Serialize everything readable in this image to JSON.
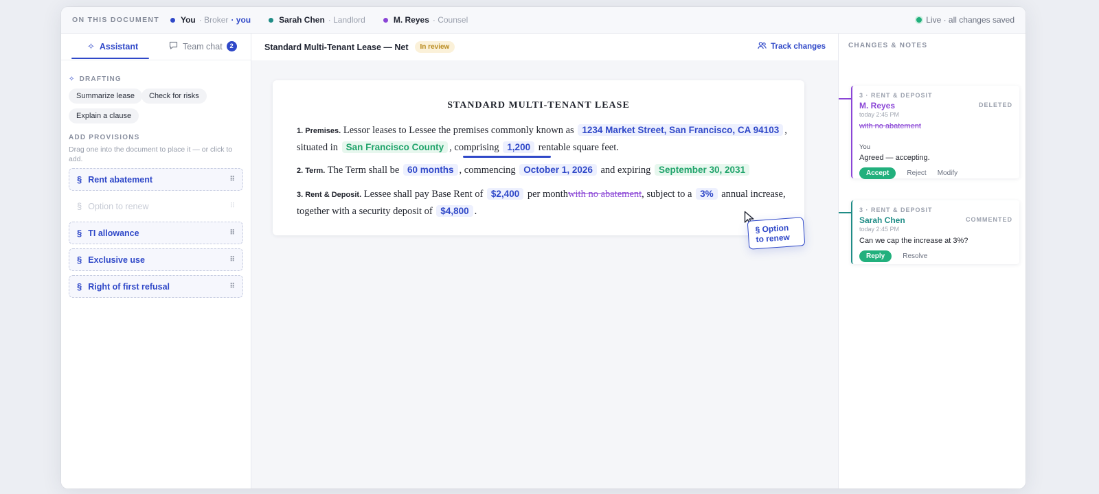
{
  "topbar": {
    "label": "ON THIS DOCUMENT",
    "participants": [
      {
        "name": "You",
        "role": "· Broker",
        "tag": "· you",
        "color": "#2f48c8"
      },
      {
        "name": "Sarah Chen",
        "role": "· Landlord",
        "tag": "",
        "color": "#1f8c86"
      },
      {
        "name": "M. Reyes",
        "role": "· Counsel",
        "tag": "",
        "color": "#8a45d6"
      }
    ],
    "live_status": "Live · all changes saved"
  },
  "left": {
    "tabs": {
      "assistant": "Assistant",
      "team_chat": "Team chat",
      "team_chat_badge": "2"
    },
    "drafting": {
      "heading": "DRAFTING",
      "actions": [
        "Summarize lease",
        "Check for risks",
        "Explain a clause"
      ]
    },
    "provisions": {
      "heading": "ADD PROVISIONS",
      "hint": "Drag one into the document to place it — or click to add.",
      "items": [
        "Rent abatement",
        "Option to renew",
        "TI allowance",
        "Exclusive use",
        "Right of first refusal"
      ]
    }
  },
  "document": {
    "title": "Standard Multi-Tenant Lease — Net",
    "status": "In review",
    "track_changes": "Track changes",
    "heading": "STANDARD MULTI-TENANT LEASE",
    "premises": {
      "num": "1. Premises.",
      "t1": "Lessor leases to Lessee the premises commonly known as",
      "address": "1234 Market Street, San Francisco, CA 94103",
      "t2": ", situated in",
      "county": "San Francisco County",
      "t3": ", comprising",
      "sqft": "1,200",
      "t4": "rentable square feet."
    },
    "term": {
      "num": "2. Term.",
      "t1": "The Term shall be",
      "months": "60 months",
      "t2": ", commencing",
      "start": "October 1, 2026",
      "t3": "and expiring",
      "end": "September 30, 2031"
    },
    "rent": {
      "num": "3. Rent & Deposit.",
      "t1": "Lessee shall pay Base Rent of",
      "rent": "$2,400",
      "t2": "per month",
      "deleted": "with no abatement",
      "t3": ", subject to a",
      "pct": "3%",
      "t4": "annual increase,",
      "t5": "together with a security deposit of",
      "deposit": "$4,800",
      "t6": "."
    },
    "drag_label": "§ Option to renew"
  },
  "right": {
    "heading": "CHANGES & NOTES",
    "notes": [
      {
        "section": "3 · RENT & DEPOSIT",
        "kind": "DELETED",
        "author": "M. Reyes",
        "time": "today 2:45 PM",
        "body": "with no abatement",
        "reply_who": "You",
        "reply": "Agreed — accepting.",
        "primary": "Accept",
        "secondary": [
          "Reject",
          "Modify"
        ]
      },
      {
        "section": "3 · RENT & DEPOSIT",
        "kind": "COMMENTED",
        "author": "Sarah Chen",
        "time": "today 2:45 PM",
        "body": "Can we cap the increase at 3%?",
        "primary": "Reply",
        "secondary": [
          "Resolve"
        ]
      }
    ]
  },
  "colors": {
    "accent": "#2f48c8",
    "green": "#22b07d",
    "purple": "#8a45d6",
    "teal": "#1f8c86",
    "pill": "#b88a1e"
  }
}
